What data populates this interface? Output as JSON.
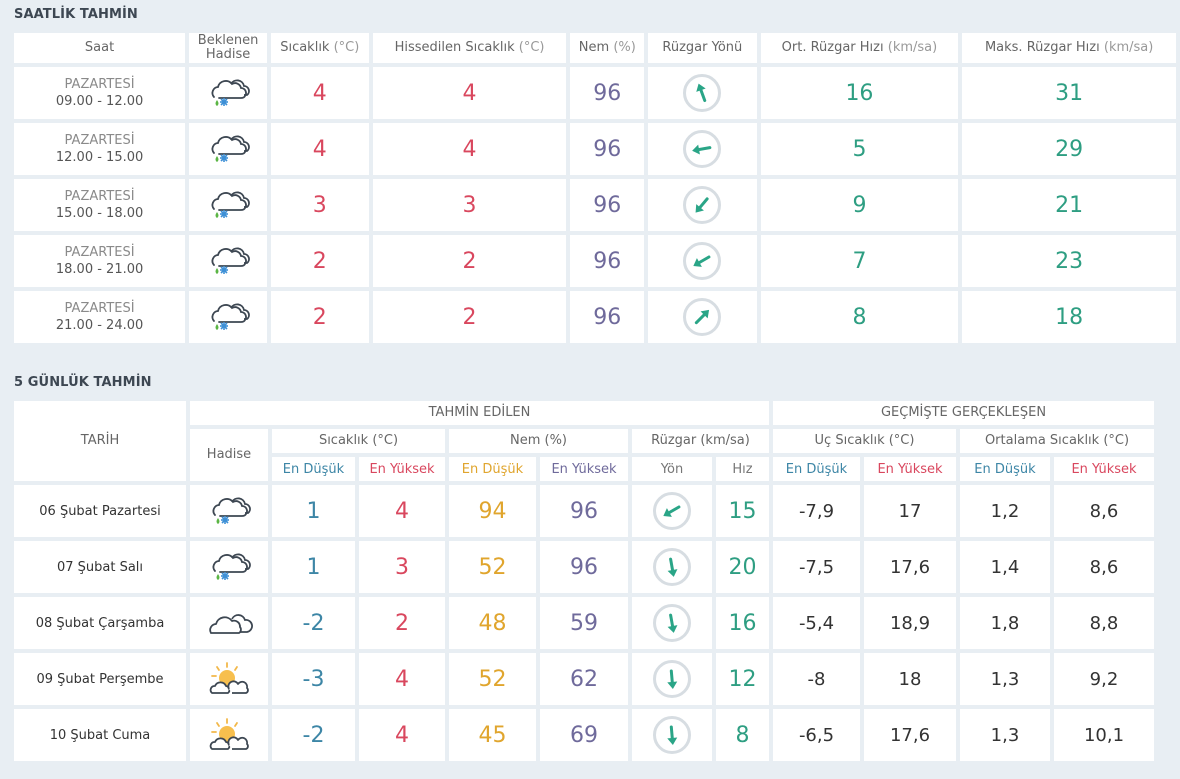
{
  "colors": {
    "background": "#e8eef3",
    "red": "#d9475e",
    "purple": "#6f6a9b",
    "teal": "#2e9e82",
    "blue": "#3d86a6",
    "orange": "#e0a52d"
  },
  "hourly": {
    "title": "SAATLİK TAHMİN",
    "headers": {
      "saat": "Saat",
      "hadise_line1": "Beklenen",
      "hadise_line2": "Hadise",
      "sicaklik": "Sıcaklık",
      "sicaklik_unit": "(°C)",
      "hissedilen": "Hissedilen Sıcaklık",
      "hissedilen_unit": "(°C)",
      "nem": "Nem",
      "nem_unit": "(%)",
      "ruzgar_yonu": "Rüzgar Yönü",
      "ort_ruzgar": "Ort. Rüzgar Hızı",
      "ort_ruzgar_unit": "(km/sa)",
      "maks_ruzgar": "Maks. Rüzgar Hızı",
      "maks_ruzgar_unit": "(km/sa)"
    },
    "rows": [
      {
        "day": "PAZARTESİ",
        "range": "09.00 - 12.00",
        "icon": "rain-snow-icon",
        "temp": "4",
        "feels": "4",
        "humidity": "96",
        "wind_dir_deg": 160,
        "wind_avg": "16",
        "wind_max": "31"
      },
      {
        "day": "PAZARTESİ",
        "range": "12.00 - 15.00",
        "icon": "rain-snow-icon",
        "temp": "4",
        "feels": "4",
        "humidity": "96",
        "wind_dir_deg": 80,
        "wind_avg": "5",
        "wind_max": "29"
      },
      {
        "day": "PAZARTESİ",
        "range": "15.00 - 18.00",
        "icon": "rain-snow-icon",
        "temp": "3",
        "feels": "3",
        "humidity": "96",
        "wind_dir_deg": 40,
        "wind_avg": "9",
        "wind_max": "21"
      },
      {
        "day": "PAZARTESİ",
        "range": "18.00 - 21.00",
        "icon": "rain-snow-icon",
        "temp": "2",
        "feels": "2",
        "humidity": "96",
        "wind_dir_deg": 60,
        "wind_avg": "7",
        "wind_max": "23"
      },
      {
        "day": "PAZARTESİ",
        "range": "21.00 - 24.00",
        "icon": "rain-snow-icon",
        "temp": "2",
        "feels": "2",
        "humidity": "96",
        "wind_dir_deg": 225,
        "wind_avg": "8",
        "wind_max": "18"
      }
    ]
  },
  "daily": {
    "title": "5 GÜNLÜK TAHMİN",
    "headers": {
      "tarih": "TARİH",
      "tahmin_edilen": "TAHMİN EDİLEN",
      "gecmiste": "GEÇMİŞTE GERÇEKLEŞEN",
      "hadise": "Hadise",
      "sicaklik": "Sıcaklık (°C)",
      "nem": "Nem (%)",
      "ruzgar": "Rüzgar (km/sa)",
      "uc_sicaklik": "Uç Sıcaklık (°C)",
      "ortalama_sicaklik": "Ortalama Sıcaklık (°C)",
      "en_dusuk": "En Düşük",
      "en_yuksek": "En Yüksek",
      "yon": "Yön",
      "hiz": "Hız"
    },
    "rows": [
      {
        "date": "06 Şubat Pazartesi",
        "icon": "rain-snow-icon",
        "temp_min": "1",
        "temp_max": "4",
        "hum_min": "94",
        "hum_max": "96",
        "wind_dir_deg": 60,
        "wind_speed": "15",
        "ext_min": "-7,9",
        "ext_max": "17",
        "avg_min": "1,2",
        "avg_max": "8,6"
      },
      {
        "date": "07 Şubat Salı",
        "icon": "rain-snow-icon",
        "temp_min": "1",
        "temp_max": "3",
        "hum_min": "52",
        "hum_max": "96",
        "wind_dir_deg": 350,
        "wind_speed": "20",
        "ext_min": "-7,5",
        "ext_max": "17,6",
        "avg_min": "1,4",
        "avg_max": "8,6"
      },
      {
        "date": "08 Şubat Çarşamba",
        "icon": "cloudy-icon",
        "temp_min": "-2",
        "temp_max": "2",
        "hum_min": "48",
        "hum_max": "59",
        "wind_dir_deg": 350,
        "wind_speed": "16",
        "ext_min": "-5,4",
        "ext_max": "18,9",
        "avg_min": "1,8",
        "avg_max": "8,8"
      },
      {
        "date": "09 Şubat Perşembe",
        "icon": "partly-cloudy-icon",
        "temp_min": "-3",
        "temp_max": "4",
        "hum_min": "52",
        "hum_max": "62",
        "wind_dir_deg": 355,
        "wind_speed": "12",
        "ext_min": "-8",
        "ext_max": "18",
        "avg_min": "1,3",
        "avg_max": "9,2"
      },
      {
        "date": "10 Şubat Cuma",
        "icon": "partly-cloudy-icon",
        "temp_min": "-2",
        "temp_max": "4",
        "hum_min": "45",
        "hum_max": "69",
        "wind_dir_deg": 355,
        "wind_speed": "8",
        "ext_min": "-6,5",
        "ext_max": "17,6",
        "avg_min": "1,3",
        "avg_max": "10,1"
      }
    ]
  }
}
